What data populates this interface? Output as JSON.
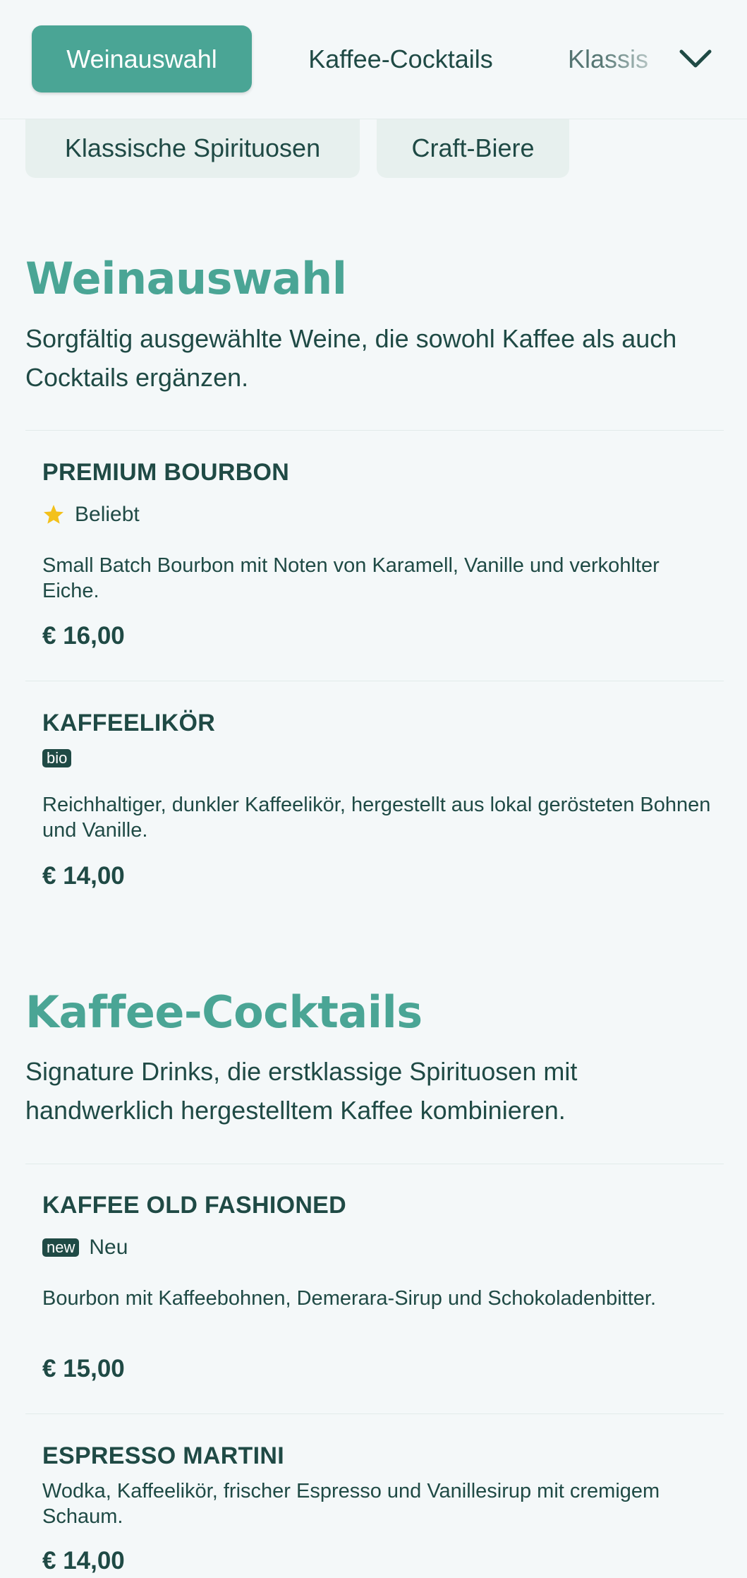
{
  "nav": {
    "tabs": [
      {
        "label": "Weinauswahl",
        "active": true
      },
      {
        "label": "Kaffee-Cocktails",
        "active": false
      },
      {
        "label": "Klassis",
        "active": false
      }
    ],
    "more_icon": "chevron-down-icon",
    "overflow_tabs": [
      {
        "label": "Klassische Spirituosen"
      },
      {
        "label": "Craft-Biere"
      }
    ]
  },
  "sections": [
    {
      "title": "Weinauswahl",
      "description": "Sorgfältig ausgewählte Weine, die sowohl Kaffee als auch Cocktails ergänzen.",
      "items": [
        {
          "name": "PREMIUM BOURBON",
          "tag_icon": "star-icon",
          "tag_label": "Beliebt",
          "description": "Small Batch Bourbon mit Noten von Karamell, Vanille und verkohlter Eiche.",
          "price": "€ 16,00"
        },
        {
          "name": "KAFFEELIKÖR",
          "badge": "bio",
          "description": "Reichhaltiger, dunkler Kaffeelikör, hergestellt aus lokal gerösteten Bohnen und Vanille.",
          "price": "€ 14,00"
        }
      ]
    },
    {
      "title": "Kaffee-Cocktails",
      "description": "Signature Drinks, die erstklassige Spirituosen mit handwerklich hergestelltem Kaffee kombinieren.",
      "items": [
        {
          "name": "KAFFEE OLD FASHIONED",
          "badge": "new",
          "tag_label": "Neu",
          "description": "Bourbon mit Kaffeebohnen, Demerara-Sirup und Schokoladenbitter.",
          "price": "€ 15,00"
        },
        {
          "name": "ESPRESSO MARTINI",
          "description": "Wodka, Kaffeelikör, frischer Espresso und Vanillesirup mit cremigem Schaum.",
          "price": "€ 14,00"
        }
      ]
    }
  ],
  "colors": {
    "accent": "#4aa595",
    "text": "#1f4a45",
    "background": "#f4f8f9",
    "pill": "#e7f0ee",
    "star": "#f3c11b"
  }
}
